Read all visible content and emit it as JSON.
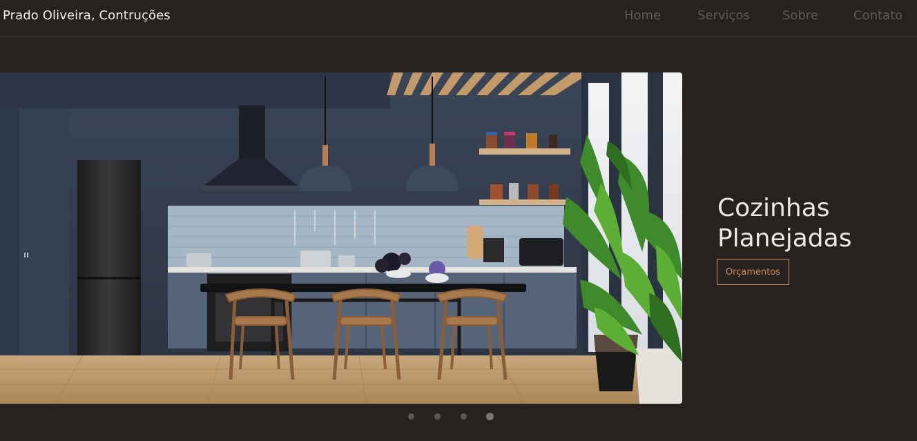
{
  "header": {
    "brand": "Prado Oliveira, Contruções",
    "nav": [
      {
        "label": "Home"
      },
      {
        "label": "Serviços"
      },
      {
        "label": "Sobre"
      },
      {
        "label": "Contato"
      }
    ]
  },
  "hero": {
    "title": "Cozinhas Planejadas",
    "button_label": "Orçamentos",
    "image_icon": "kitchen-photo",
    "accent_color": "#d18a5b"
  },
  "carousel": {
    "slide_count": 4,
    "active_slide": 4
  }
}
